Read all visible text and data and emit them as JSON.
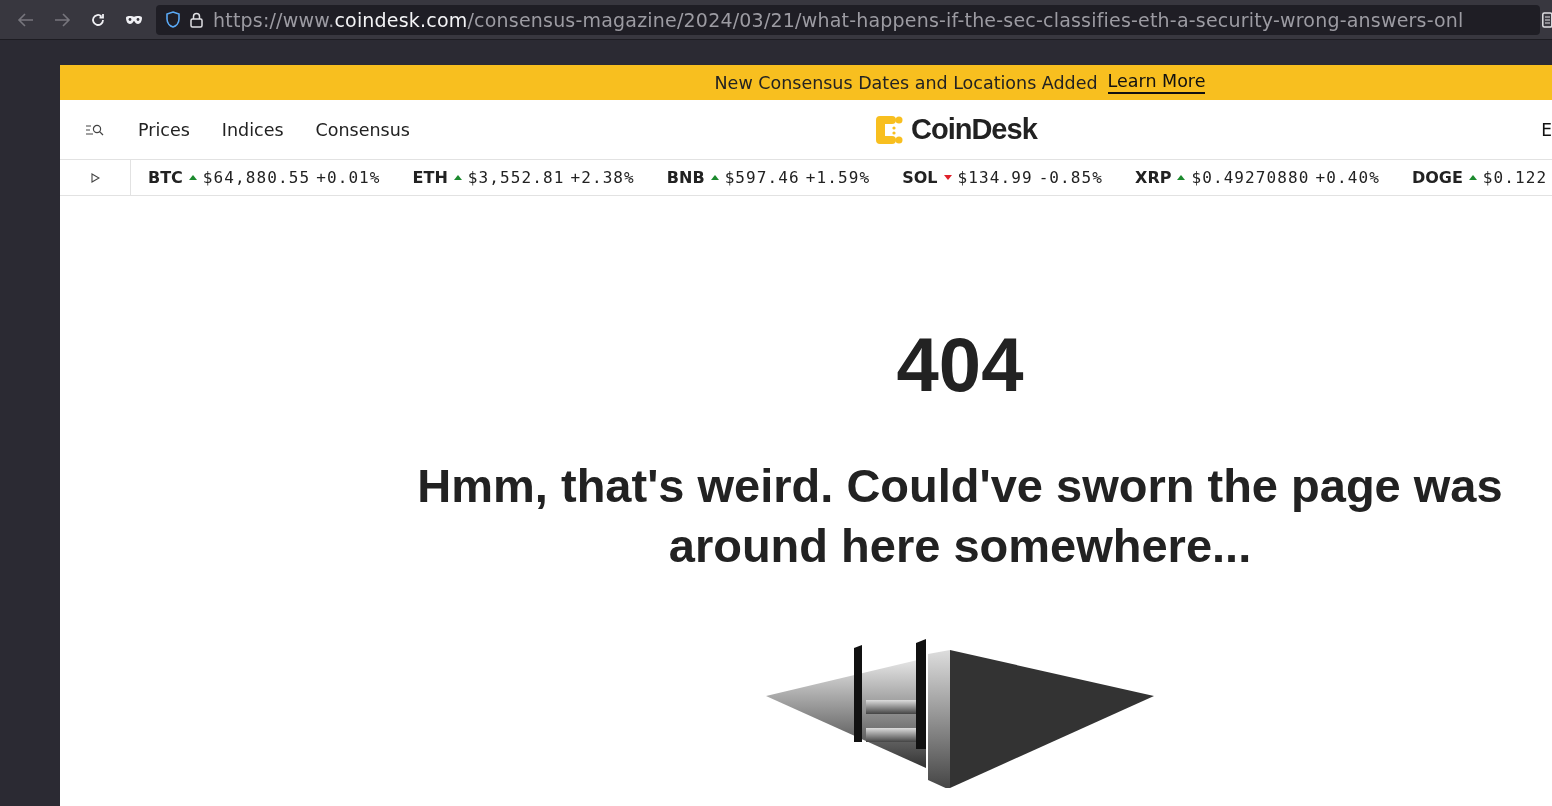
{
  "browser": {
    "url": {
      "scheme": "https://www.",
      "domain": "coindesk.com",
      "path": "/consensus-magazine/2024/03/21/what-happens-if-the-sec-classifies-eth-a-security-wrong-answers-onl"
    },
    "back_disabled": true,
    "forward_disabled": true
  },
  "banner": {
    "text": "New Consensus Dates and Locations Added",
    "link": "Learn More"
  },
  "nav": {
    "links": [
      "Prices",
      "Indices",
      "Consensus"
    ],
    "logo": "CoinDesk",
    "right": "E"
  },
  "ticker": [
    {
      "symbol": "BTC",
      "rising": true,
      "price": "$64,880.55",
      "change": "+0.01%"
    },
    {
      "symbol": "ETH",
      "rising": true,
      "price": "$3,552.81",
      "change": "+2.38%"
    },
    {
      "symbol": "BNB",
      "rising": true,
      "price": "$597.46",
      "change": "+1.59%"
    },
    {
      "symbol": "SOL",
      "rising": false,
      "price": "$134.99",
      "change": "-0.85%"
    },
    {
      "symbol": "XRP",
      "rising": true,
      "price": "$0.49270880",
      "change": "+0.40%"
    },
    {
      "symbol": "DOGE",
      "rising": true,
      "price": "$0.122"
    }
  ],
  "error": {
    "code": "404",
    "message": "Hmm, that's weird. Could've sworn the page was around here somewhere..."
  }
}
